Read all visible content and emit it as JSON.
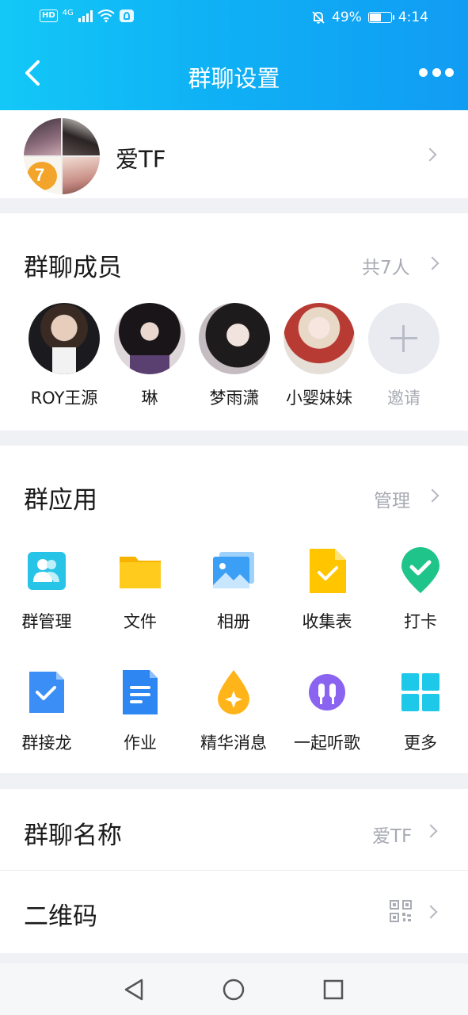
{
  "status_bar": {
    "hd": "HD",
    "net": "4G",
    "battery_text": "49%",
    "battery_level": 0.49,
    "time": "4:14"
  },
  "nav": {
    "title": "群聊设置"
  },
  "group": {
    "name": "爱TF"
  },
  "members_section": {
    "title": "群聊成员",
    "count": "共7人",
    "members": [
      {
        "name": "ROY王源"
      },
      {
        "name": "琳"
      },
      {
        "name": "梦雨潇"
      },
      {
        "name": "小婴妹妹"
      }
    ],
    "invite_label": "邀请"
  },
  "apps_section": {
    "title": "群应用",
    "manage": "管理",
    "apps": [
      {
        "label": "群管理",
        "icon": "group-manage-icon"
      },
      {
        "label": "文件",
        "icon": "folder-icon"
      },
      {
        "label": "相册",
        "icon": "photo-album-icon"
      },
      {
        "label": "收集表",
        "icon": "collection-form-icon"
      },
      {
        "label": "打卡",
        "icon": "check-in-icon"
      },
      {
        "label": "群接龙",
        "icon": "relay-icon"
      },
      {
        "label": "作业",
        "icon": "homework-icon"
      },
      {
        "label": "精华消息",
        "icon": "essence-icon"
      },
      {
        "label": "一起听歌",
        "icon": "listen-together-icon"
      },
      {
        "label": "更多",
        "icon": "more-apps-icon"
      }
    ]
  },
  "rows": {
    "group_name_label": "群聊名称",
    "group_name_value": "爱TF",
    "qrcode_label": "二维码"
  },
  "colors": {
    "header_start": "#13c8f7",
    "header_end": "#119cf3",
    "background": "#f0f1f5",
    "secondary_text": "#a8abb3"
  }
}
